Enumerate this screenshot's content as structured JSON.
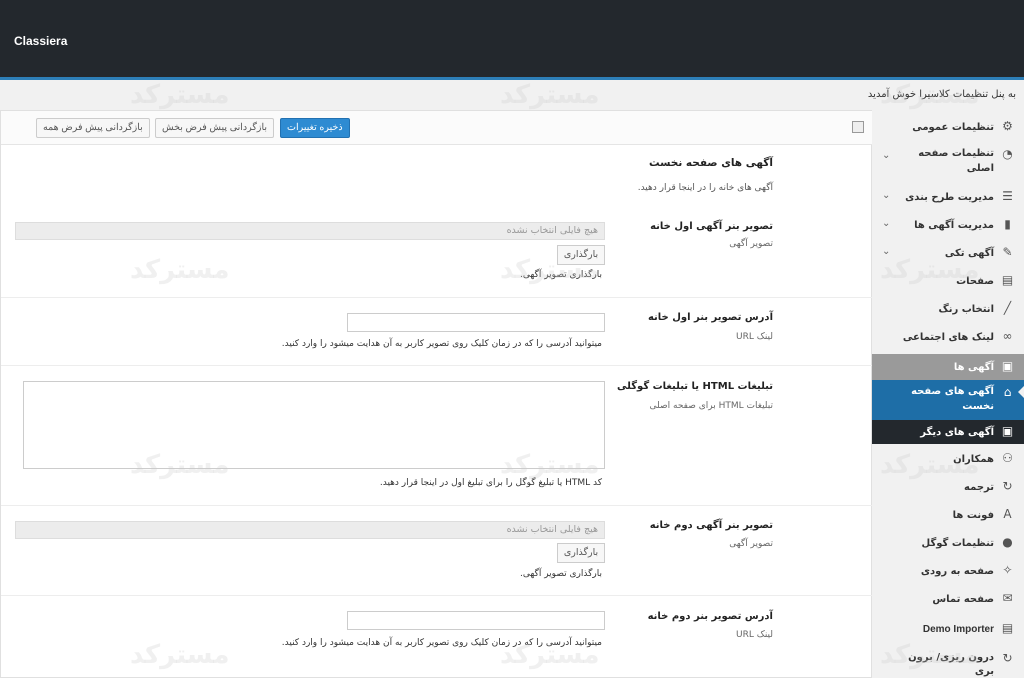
{
  "header": {
    "brand": "Classiera"
  },
  "welcome": "به پنل تنظیمات کلاسیرا خوش آمدید",
  "toolbar": {
    "save_label": "ذخیره تغییرات",
    "reset_section_label": "بازگردانی پیش فرض بخش",
    "reset_all_label": "بازگردانی پیش فرض همه"
  },
  "section": {
    "title": "آگهی های صفحه نخست",
    "description": "آگهی های خانه را در اینجا قرار دهید."
  },
  "fields": {
    "banner1": {
      "label": "تصویر بنر آگهی اول خانه",
      "sub": "تصویر آگهی",
      "file_placeholder": "هیچ فایلی انتخاب نشده",
      "upload_label": "بارگذاری",
      "hint": "بارگذاری تصویر آگهی."
    },
    "banner1_url": {
      "label": "آدرس تصویر بنر اول خانه",
      "sub": "لینک URL",
      "hint": "میتوانید آدرسی را که در زمان کلیک روی تصویر کاربر به آن هدایت میشود را وارد کنید."
    },
    "html_ads": {
      "label": "تبلیغات HTML یا تبلیغات گوگلی",
      "sub": "تبلیغات HTML برای صفحه اصلی",
      "hint": "کد HTML یا تبلیغ گوگل را برای تبلیغ اول در اینجا قرار دهید."
    },
    "banner2": {
      "label": "تصویر بنر آگهی دوم خانه",
      "sub": "تصویر آگهی",
      "file_placeholder": "هیچ فایلی انتخاب نشده",
      "upload_label": "بارگذاری",
      "hint": "بارگذاری تصویر آگهی."
    },
    "banner2_url": {
      "label": "آدرس تصویر بنر دوم خانه",
      "sub": "لینک URL",
      "hint": "میتوانید آدرسی را که در زمان کلیک روی تصویر کاربر به آن هدایت میشود را وارد کنید."
    }
  },
  "sidebar": {
    "items": [
      {
        "label": "تنظیمات عمومی",
        "icon": "gear-icon"
      },
      {
        "label": "تنظیمات صفحه",
        "label2": "اصلی",
        "icon": "dashboard-icon"
      },
      {
        "label": "مدیریت طرح بندی",
        "icon": "list-icon"
      },
      {
        "label": "مدیریت آگهی ها",
        "icon": "chart-icon"
      },
      {
        "label": "آگهی تکی",
        "icon": "pencil-icon"
      },
      {
        "label": "صفحات",
        "icon": "page-icon"
      },
      {
        "label": "انتخاب رنگ",
        "icon": "brush-icon"
      },
      {
        "label": "لینک های اجتماعی",
        "icon": "glasses-icon"
      },
      {
        "label": "آگهی ها",
        "icon": "image-icon"
      },
      {
        "label": "آگهی های صفحه",
        "label2": "نخست",
        "icon": "home-icon"
      },
      {
        "label": "آگهی های دیگر",
        "icon": "image-icon"
      },
      {
        "label": "همکاران",
        "icon": "users-icon"
      },
      {
        "label": "ترجمه",
        "icon": "refresh-icon"
      },
      {
        "label": "فونت ها",
        "icon": "font-icon"
      },
      {
        "label": "تنظیمات گوگل",
        "icon": "pin-icon"
      },
      {
        "label": "صفحه به رودی",
        "icon": "wand-icon"
      },
      {
        "label": "صفحه تماس",
        "icon": "mail-icon"
      },
      {
        "label": "Demo Importer",
        "icon": "page-icon"
      },
      {
        "label": "درون ریزی/ برون",
        "label2": "بری",
        "icon": "refresh-icon"
      }
    ]
  },
  "watermark": "مسترکد"
}
